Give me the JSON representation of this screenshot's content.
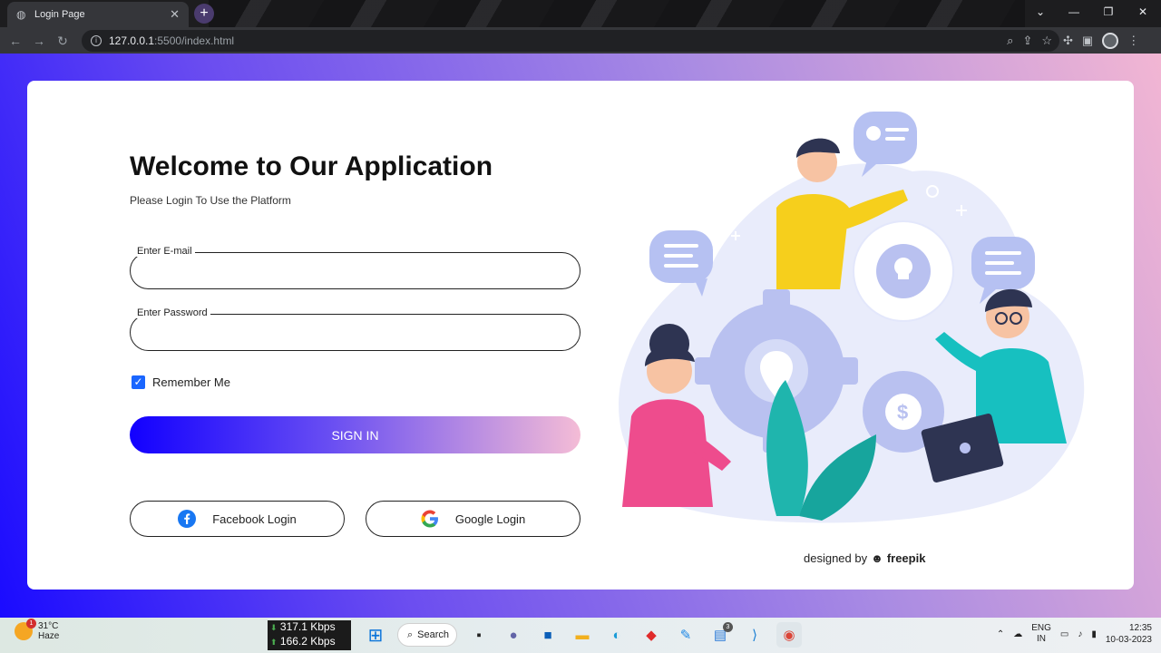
{
  "browser": {
    "tab_title": "Login Page",
    "url_host": "127.0.0.1",
    "url_path": ":5500/index.html"
  },
  "page": {
    "heading": "Welcome to Our Application",
    "subheading": "Please Login To Use the Platform",
    "email_label": "Enter E-mail",
    "email_value": "",
    "password_label": "Enter Password",
    "password_value": "",
    "remember_label": "Remember Me",
    "remember_checked": true,
    "signin_label": "SIGN IN",
    "facebook_label": "Facebook Login",
    "google_label": "Google Login",
    "credit_prefix": "designed by",
    "credit_brand": "freepik"
  },
  "taskbar": {
    "weather_temp": "31°C",
    "weather_desc": "Haze",
    "weather_badge": "1",
    "net_down": "317.1 Kbps",
    "net_up": "166.2 Kbps",
    "search_label": "Search",
    "lang_top": "ENG",
    "lang_bottom": "IN",
    "time": "12:35",
    "date": "10-03-2023",
    "badge_count": "3"
  },
  "colors": {
    "gradient_start": "#1a0bff",
    "gradient_end": "#f2b6d3",
    "checkbox": "#1a66ff"
  }
}
